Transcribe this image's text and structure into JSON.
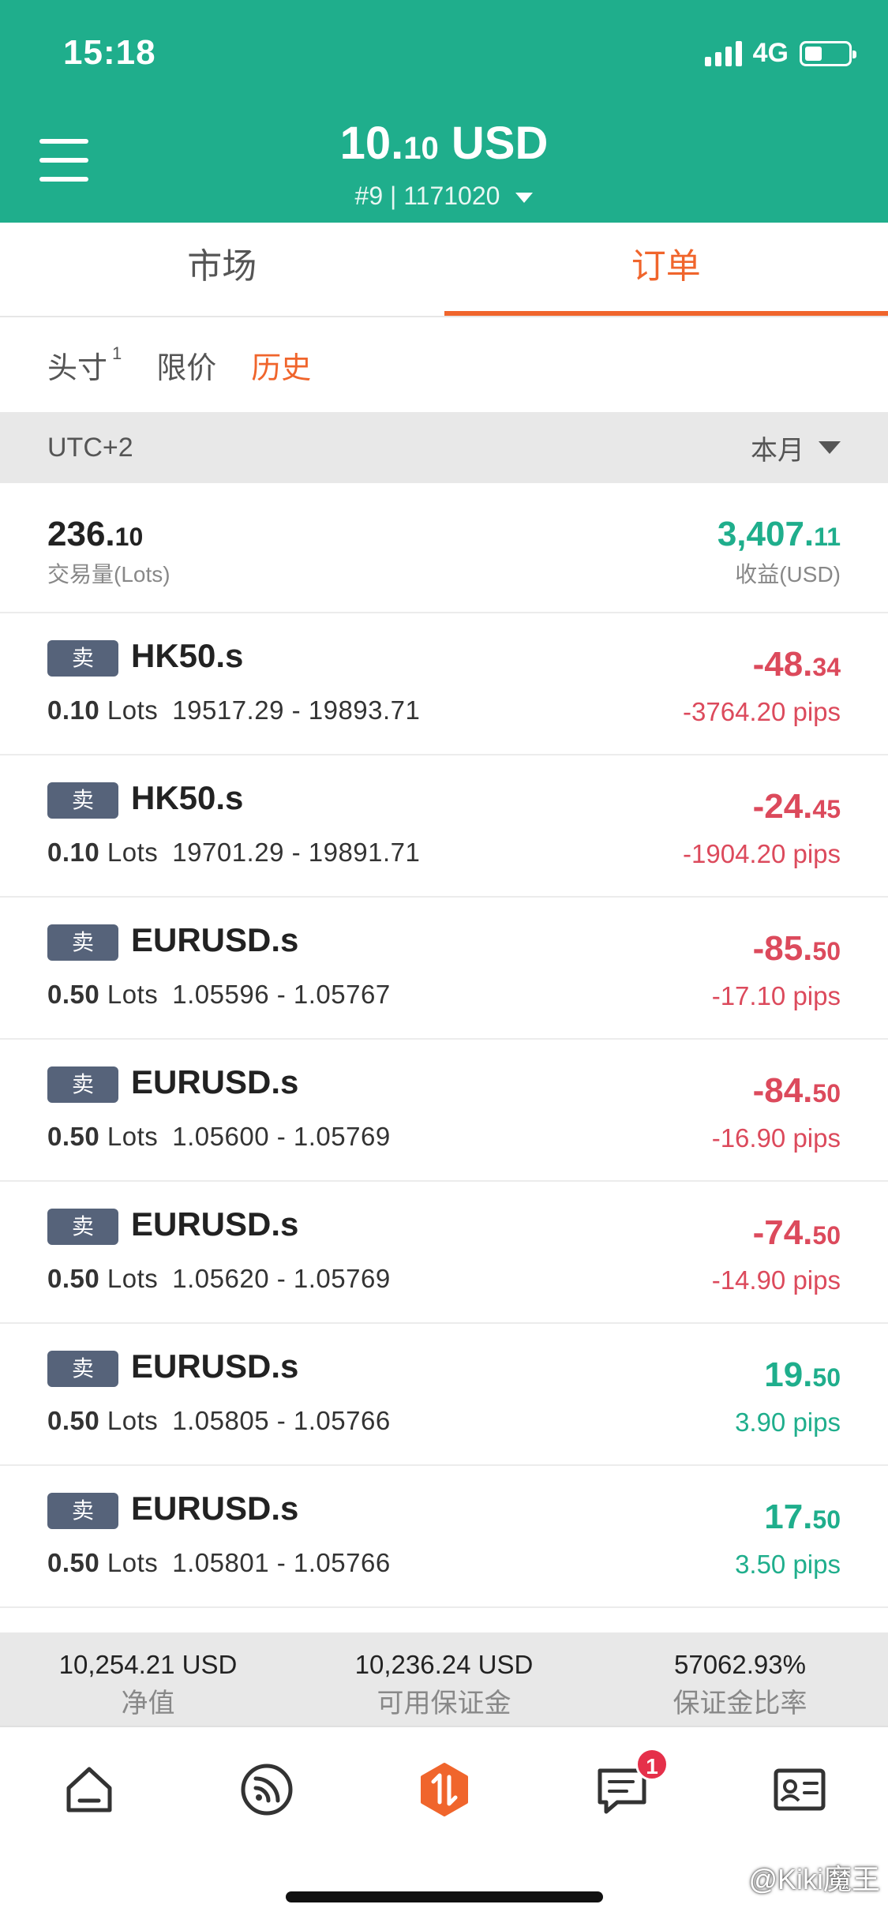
{
  "status_bar": {
    "time": "15:18",
    "network": "4G"
  },
  "header": {
    "balance_int": "10.",
    "balance_dec": "10",
    "balance_currency": " USD",
    "account": "#9 | 1171020"
  },
  "main_tabs": [
    {
      "label": "市场",
      "active": false
    },
    {
      "label": "订单",
      "active": true
    }
  ],
  "sub_tabs": {
    "positions": {
      "label": "头寸",
      "count": "1"
    },
    "limit": {
      "label": "限价"
    },
    "history": {
      "label": "历史"
    }
  },
  "filter": {
    "timezone": "UTC+2",
    "period": "本月"
  },
  "summary": {
    "volume_int": "236.",
    "volume_dec": "10",
    "volume_label": "交易量(Lots)",
    "profit_int": "3,407.",
    "profit_dec": "11",
    "profit_label": "收益(USD)"
  },
  "orders": [
    {
      "side": "卖",
      "symbol": "HK50.s",
      "lots": "0.10",
      "lots_unit": "Lots",
      "prices": "19517.29 - 19893.71",
      "pl_int": "-48.",
      "pl_dec": "34",
      "pips": "-3764.20 pips",
      "sign": "neg"
    },
    {
      "side": "卖",
      "symbol": "HK50.s",
      "lots": "0.10",
      "lots_unit": "Lots",
      "prices": "19701.29 - 19891.71",
      "pl_int": "-24.",
      "pl_dec": "45",
      "pips": "-1904.20 pips",
      "sign": "neg"
    },
    {
      "side": "卖",
      "symbol": "EURUSD.s",
      "lots": "0.50",
      "lots_unit": "Lots",
      "prices": "1.05596 - 1.05767",
      "pl_int": "-85.",
      "pl_dec": "50",
      "pips": "-17.10 pips",
      "sign": "neg"
    },
    {
      "side": "卖",
      "symbol": "EURUSD.s",
      "lots": "0.50",
      "lots_unit": "Lots",
      "prices": "1.05600 - 1.05769",
      "pl_int": "-84.",
      "pl_dec": "50",
      "pips": "-16.90 pips",
      "sign": "neg"
    },
    {
      "side": "卖",
      "symbol": "EURUSD.s",
      "lots": "0.50",
      "lots_unit": "Lots",
      "prices": "1.05620 - 1.05769",
      "pl_int": "-74.",
      "pl_dec": "50",
      "pips": "-14.90 pips",
      "sign": "neg"
    },
    {
      "side": "卖",
      "symbol": "EURUSD.s",
      "lots": "0.50",
      "lots_unit": "Lots",
      "prices": "1.05805 - 1.05766",
      "pl_int": "19.",
      "pl_dec": "50",
      "pips": "3.90 pips",
      "sign": "pos"
    },
    {
      "side": "卖",
      "symbol": "EURUSD.s",
      "lots": "0.50",
      "lots_unit": "Lots",
      "prices": "1.05801 - 1.05766",
      "pl_int": "17.",
      "pl_dec": "50",
      "pips": "3.50 pips",
      "sign": "pos"
    }
  ],
  "stats": [
    {
      "value": "10,254.21 USD",
      "label": "净值"
    },
    {
      "value": "10,236.24 USD",
      "label": "可用保证金"
    },
    {
      "value": "57062.93%",
      "label": "保证金比率"
    }
  ],
  "nav": {
    "items": [
      "home-icon",
      "feed-icon",
      "trade-icon",
      "messages-icon",
      "profile-card-icon"
    ],
    "messages_badge": "1"
  },
  "watermark": "@Kiki魔王",
  "colors": {
    "brand": "#1fae8c",
    "accent": "#f0652c",
    "loss": "#dc4a5c",
    "gain": "#1fae8c",
    "badge": "#56637a"
  }
}
